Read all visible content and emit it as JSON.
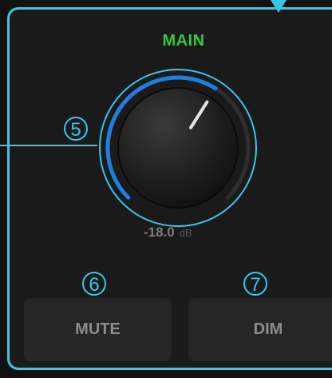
{
  "channel": {
    "title": "MAIN"
  },
  "knob": {
    "value": "-18.0",
    "unit": "dB",
    "level_fraction": 0.62
  },
  "buttons": {
    "mute_label": "MUTE",
    "dim_label": "DIM"
  },
  "callouts": {
    "knob_number": "5",
    "mute_number": "6",
    "dim_number": "7"
  },
  "colors": {
    "accent": "#38c6ea",
    "title": "#39c640",
    "knob_arc": "#1f7fe0",
    "panel": "#1a1a1a",
    "button": "#262626"
  }
}
